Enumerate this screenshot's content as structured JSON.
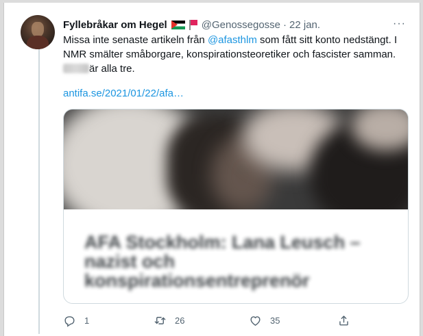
{
  "tweet": {
    "display_name": "Fyllebråkar om Hegel",
    "handle": "@Genossegosse",
    "separator": "·",
    "time": "22 jan.",
    "more_menu": "···",
    "text_part1": "Missa inte senaste artikeln från ",
    "mention": "@afasthlm",
    "text_part2": " som fått sitt konto nedstängt. I NMR smälter småborgare, konspirationsteoretiker och fascister samman. ",
    "text_part3": "är alla tre.",
    "link": "antifa.se/2021/01/22/afa…",
    "card_title": "AFA Stockholm: Lana Leusch – nazist och konspirationsentreprenör"
  },
  "actions": {
    "reply_count": "1",
    "retweet_count": "26",
    "like_count": "35"
  },
  "icons": [
    "reply-icon",
    "retweet-icon",
    "like-icon",
    "share-icon",
    "more-icon",
    "palestine-flag-icon",
    "red-flag-icon"
  ],
  "colors": {
    "link": "#1b95e0",
    "text": "#0f1419",
    "muted": "#536471",
    "border": "#cfd9de"
  }
}
